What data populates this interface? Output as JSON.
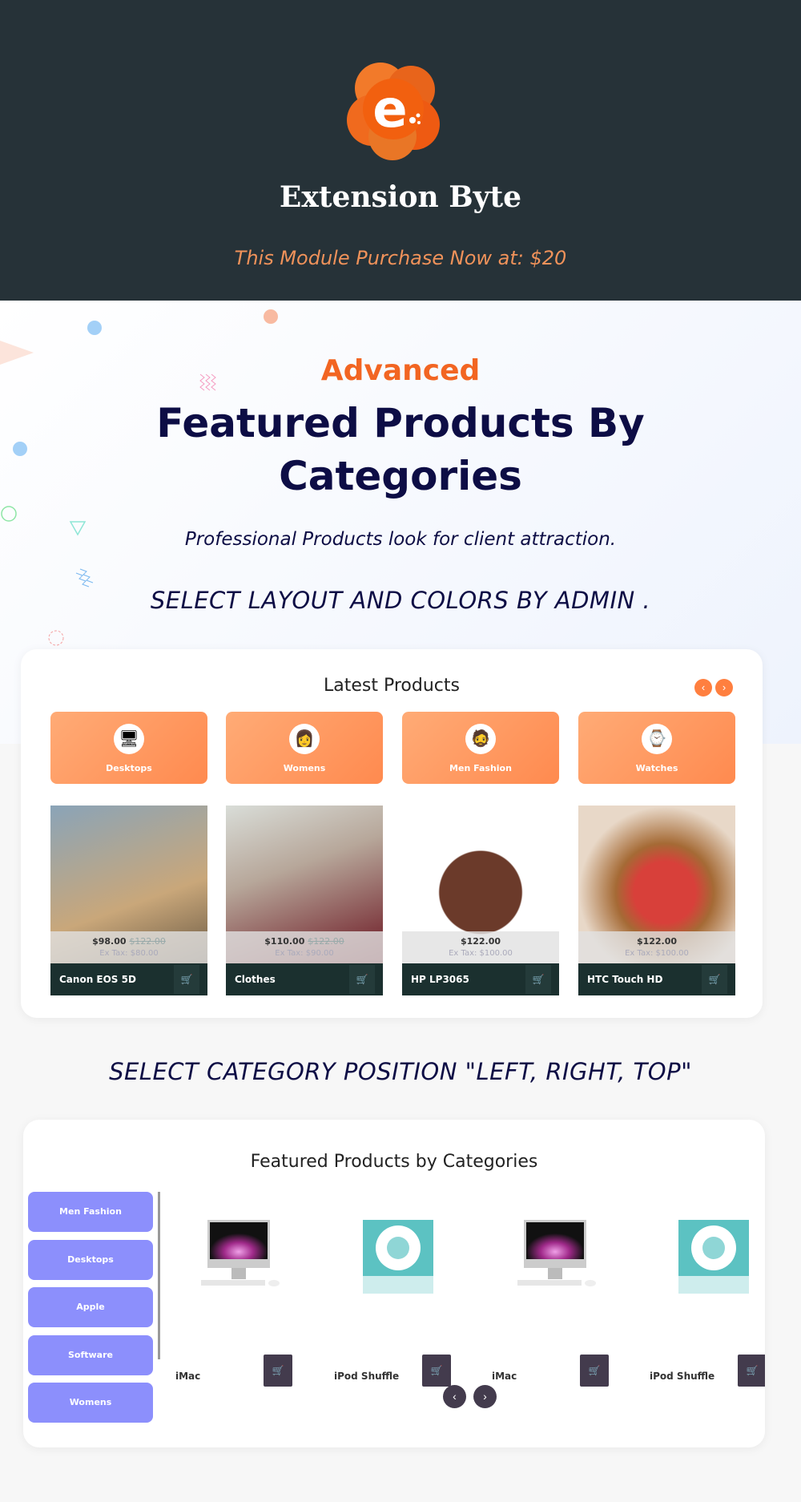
{
  "header": {
    "brand": "Extension Byte",
    "tagline": "This Module Purchase Now at: $20",
    "logo_letter": "e"
  },
  "hero": {
    "eyebrow": "Advanced",
    "title_line1": "Featured Products By",
    "title_line2": "Categories",
    "subtitle": "Professional Products look for client attraction.",
    "layout_note": "SELECT LAYOUT AND COLORS BY ADMIN ."
  },
  "latest": {
    "title": "Latest Products",
    "prev": "‹",
    "next": "›",
    "categories": [
      {
        "label": "Desktops",
        "icon": "desktop-icon",
        "glyph": "🖥"
      },
      {
        "label": "Womens",
        "icon": "woman-avatar",
        "glyph": "👩"
      },
      {
        "label": "Men Fashion",
        "icon": "man-avatar",
        "glyph": "🧔"
      },
      {
        "label": "Watches",
        "icon": "watch-icon",
        "glyph": "⌚"
      }
    ],
    "products": [
      {
        "name": "Canon EOS 5D",
        "price": "$98.00",
        "old_price": "$122.00",
        "ex_tax": "Ex Tax: $80.00",
        "bg": "linear-gradient(160deg,#8aa4b8,#c9a77a 60%,#6b5a44)"
      },
      {
        "name": "Clothes",
        "price": "$110.00",
        "old_price": "$122.00",
        "ex_tax": "Ex Tax: $90.00",
        "bg": "linear-gradient(160deg,#d9ddd8,#b7a79a 40%,#6a1420)"
      },
      {
        "name": "HP LP3065",
        "price": "$122.00",
        "old_price": "",
        "ex_tax": "Ex Tax: $100.00",
        "bg": "radial-gradient(circle at 50% 55%,#6b3a2a 0 35%,#fff 36%)"
      },
      {
        "name": "HTC Touch HD",
        "price": "$122.00",
        "old_price": "",
        "ex_tax": "Ex Tax: $100.00",
        "bg": "radial-gradient(circle at 55% 55%,#d8403a 0 25%,#a56a35 40%,#e8d8c8 70%)"
      }
    ],
    "cart_glyph": "🛒"
  },
  "category_note": "SELECT CATEGORY POSITION \"LEFT, RIGHT, TOP\"",
  "featured": {
    "title": "Featured Products by Categories",
    "sidebar": [
      "Men Fashion",
      "Desktops",
      "Apple",
      "Software",
      "Womens"
    ],
    "products": [
      {
        "name": "iMac",
        "kind": "imac"
      },
      {
        "name": "iPod Shuffle",
        "kind": "ipod"
      },
      {
        "name": "iMac",
        "kind": "imac"
      },
      {
        "name": "iPod Shuffle",
        "kind": "ipod"
      }
    ],
    "prev": "‹",
    "next": "›"
  },
  "colors": {
    "accent": "#f26522",
    "navy": "#0d0d45",
    "header_bg": "#263238",
    "tile": "#ff8a4f",
    "sidebar": "#8c8ffc",
    "dark_button": "#433b4d"
  }
}
